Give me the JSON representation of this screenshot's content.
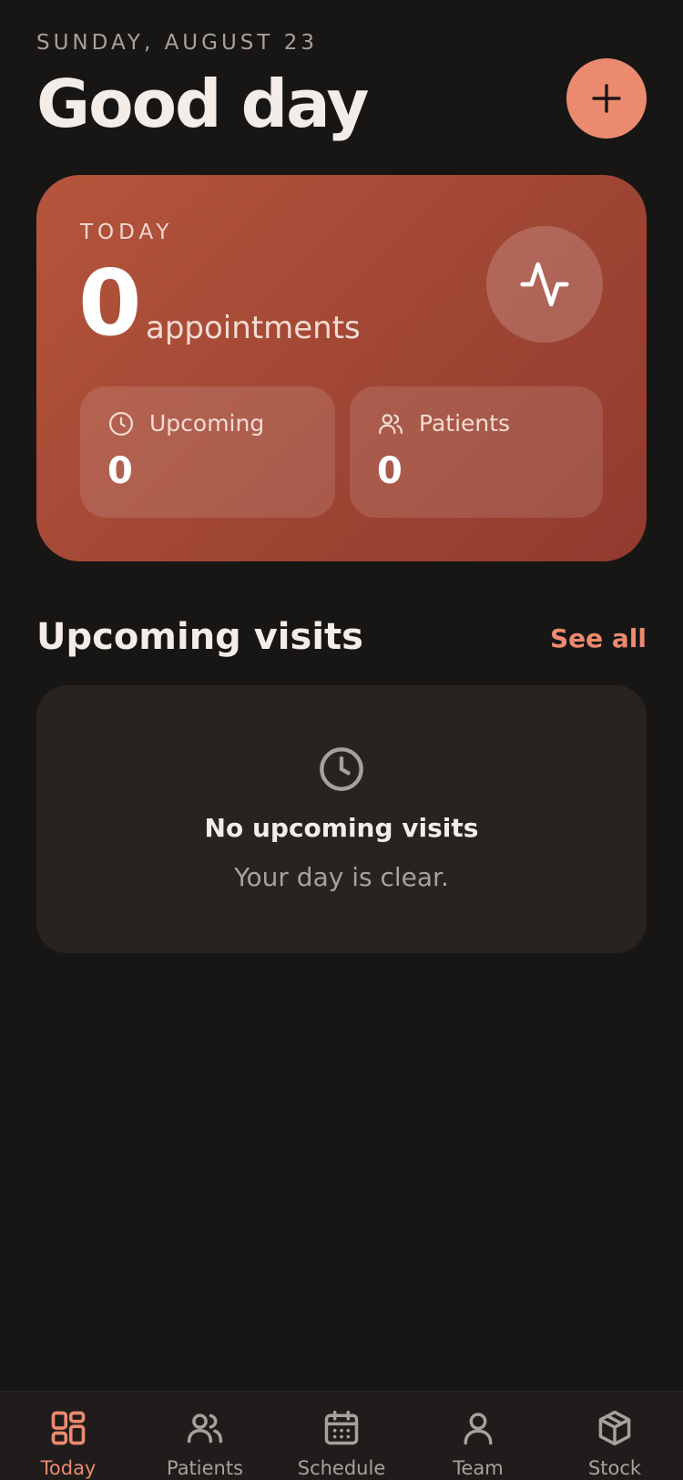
{
  "header": {
    "date": "SUNDAY, AUGUST 23",
    "greeting": "Good day"
  },
  "summary": {
    "label": "TODAY",
    "count": "0",
    "unit": "appointments",
    "stats": [
      {
        "label": "Upcoming",
        "value": "0",
        "icon": "clock-icon"
      },
      {
        "label": "Patients",
        "value": "0",
        "icon": "users-icon"
      }
    ]
  },
  "visits": {
    "title": "Upcoming visits",
    "see_all": "See all",
    "empty_title": "No upcoming visits",
    "empty_subtitle": "Your day is clear."
  },
  "tabs": [
    {
      "label": "Today",
      "icon": "grid-icon",
      "active": true
    },
    {
      "label": "Patients",
      "icon": "users-icon",
      "active": false
    },
    {
      "label": "Schedule",
      "icon": "calendar-icon",
      "active": false
    },
    {
      "label": "Team",
      "icon": "person-icon",
      "active": false
    },
    {
      "label": "Stock",
      "icon": "package-icon",
      "active": false
    }
  ],
  "colors": {
    "background": "#171615",
    "accent": "#ec8a6f",
    "card": "#272321",
    "hero": "#a04634"
  }
}
